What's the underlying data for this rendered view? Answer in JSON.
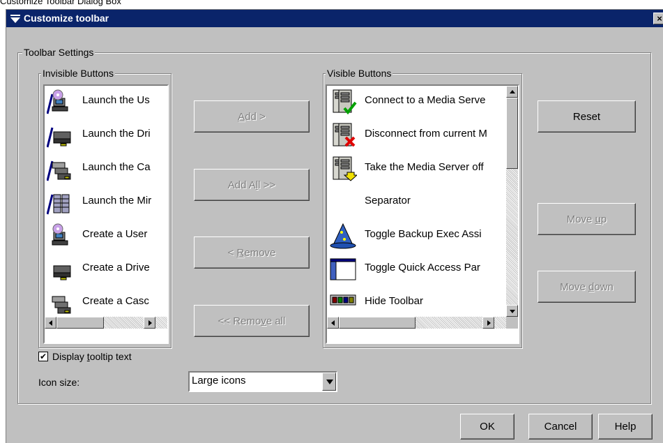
{
  "caption": "Customize Toolbar Dialog Box",
  "dialog": {
    "title": "Customize toolbar",
    "close_label": "×"
  },
  "toolbar_settings": {
    "label": "Toolbar Settings"
  },
  "invisible": {
    "label": "Invisible Buttons",
    "items": [
      {
        "label": "Launch the Us",
        "icon": "user-wizard-icon"
      },
      {
        "label": "Launch the Dri",
        "icon": "drive-wizard-icon"
      },
      {
        "label": "Launch the Ca",
        "icon": "cascade-wizard-icon"
      },
      {
        "label": "Launch the Mir",
        "icon": "mirror-wizard-icon"
      },
      {
        "label": "Create a User",
        "icon": "user-pool-icon"
      },
      {
        "label": "Create a Drive",
        "icon": "drive-pool-icon"
      },
      {
        "label": "Create a Casc",
        "icon": "cascade-pool-icon"
      }
    ]
  },
  "visible": {
    "label": "Visible Buttons",
    "items": [
      {
        "label": "Connect to a Media Serve",
        "icon": "server-connect-icon"
      },
      {
        "label": "Disconnect from current M",
        "icon": "server-disconnect-icon"
      },
      {
        "label": "Take the Media Server off",
        "icon": "server-offline-icon"
      },
      {
        "label": "Separator",
        "icon": ""
      },
      {
        "label": "Toggle Backup Exec Assi",
        "icon": "wizard-hat-icon"
      },
      {
        "label": "Toggle Quick Access Par",
        "icon": "panel-icon"
      },
      {
        "label": "Hide Toolbar",
        "icon": "toolbar-icon"
      }
    ]
  },
  "buttons": {
    "add": {
      "pre": "",
      "key": "A",
      "post": "dd >"
    },
    "add_all": {
      "pre": "Add A",
      "key": "l",
      "post": "l >>"
    },
    "remove": {
      "pre": "< ",
      "key": "R",
      "post": "emove"
    },
    "remove_all": {
      "pre": "<< Remo",
      "key": "v",
      "post": "e all"
    },
    "reset": "Reset",
    "move_up": {
      "pre": "Move ",
      "key": "u",
      "post": "p"
    },
    "move_down": {
      "pre": "Move ",
      "key": "d",
      "post": "own"
    },
    "ok": "OK",
    "cancel": "Cancel",
    "help": "Help"
  },
  "tooltip": {
    "checked": true,
    "check_mark": "✔",
    "pre": "Display ",
    "key": "t",
    "post": "ooltip text"
  },
  "icon_size": {
    "label": "Icon size:",
    "value": "Large icons"
  }
}
